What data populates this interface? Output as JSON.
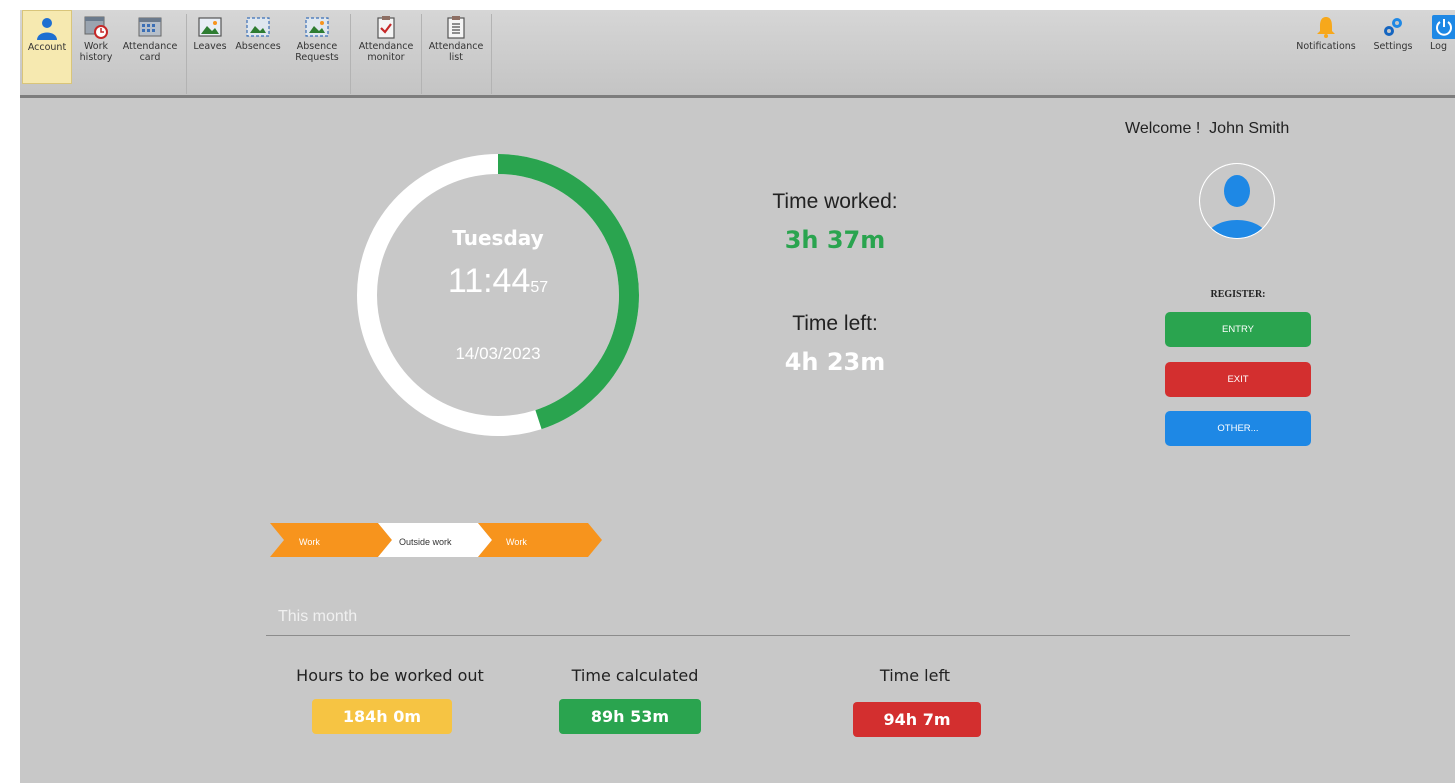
{
  "toolbar": {
    "left_items": [
      {
        "label_line1": "Account",
        "label_line2": "",
        "icon": "person-icon",
        "active": true
      },
      {
        "label_line1": "Work",
        "label_line2": "history",
        "icon": "calendar-clock-icon"
      },
      {
        "label_line1": "Attendance",
        "label_line2": "card",
        "icon": "calendar-grid-icon"
      },
      {
        "label_line1": "Leaves",
        "label_line2": "",
        "icon": "picture-icon"
      },
      {
        "label_line1": "Absences",
        "label_line2": "",
        "icon": "picture-dashed-icon"
      },
      {
        "label_line1": "Absence",
        "label_line2": "Requests",
        "icon": "picture-request-icon"
      },
      {
        "label_line1": "Attendance",
        "label_line2": "monitor",
        "icon": "clipboard-check-icon"
      },
      {
        "label_line1": "Attendance",
        "label_line2": "list",
        "icon": "clipboard-list-icon"
      }
    ],
    "right_items": [
      {
        "label": "Notifications",
        "icon": "bell-icon"
      },
      {
        "label": "Settings",
        "icon": "gears-icon"
      },
      {
        "label": "Log",
        "icon": "power-icon"
      }
    ]
  },
  "clock": {
    "day": "Tuesday",
    "time_hm": "11:44",
    "time_sec": "57",
    "date": "14/03/2023",
    "progress_fraction": 0.45
  },
  "summary": {
    "time_worked_label": "Time worked:",
    "time_worked_value": "3h 37m",
    "time_left_label": "Time left:",
    "time_left_value": "4h 23m"
  },
  "user": {
    "welcome": "Welcome !  John Smith",
    "avatar_icon": "user-avatar-icon"
  },
  "register": {
    "title": "REGISTER:",
    "entry_label": "ENTRY",
    "exit_label": "EXIT",
    "other_label": "OTHER..."
  },
  "timeline": {
    "steps": [
      "Work",
      "Outside work",
      "Work"
    ]
  },
  "month": {
    "title": "This month",
    "hours_label": "Hours to be worked out",
    "hours_value": "184h 0m",
    "calculated_label": "Time calculated",
    "calculated_value": "89h 53m",
    "left_label": "Time left",
    "left_value": "94h 7m"
  },
  "colors": {
    "green": "#2aa44f",
    "red": "#d32f2f",
    "blue": "#1e88e5",
    "orange": "#f7941d",
    "yellow": "#f6c443",
    "background": "#c8c8c8"
  }
}
